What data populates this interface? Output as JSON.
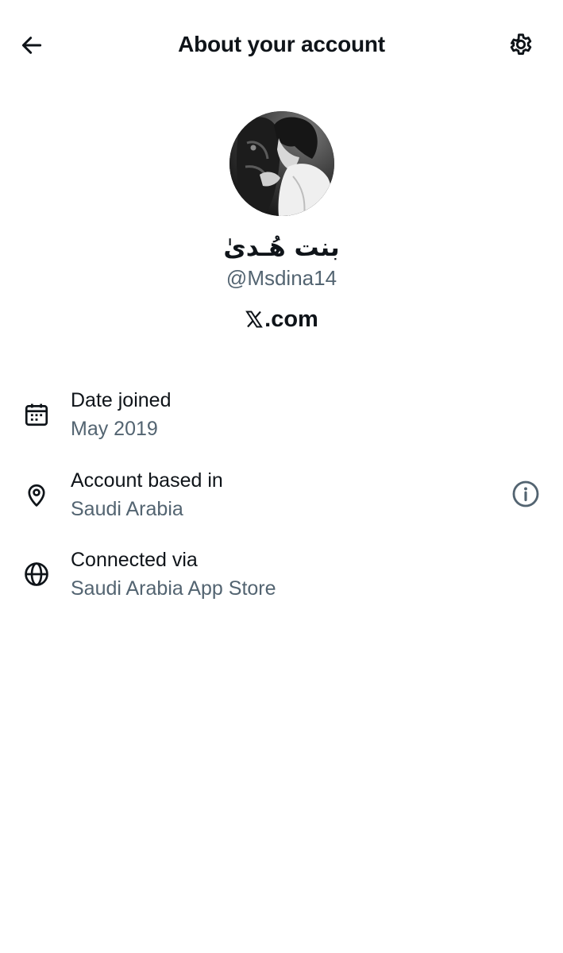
{
  "header": {
    "title": "About your account",
    "back_icon": "arrow-left-icon",
    "settings_icon": "gear-icon"
  },
  "profile": {
    "display_name": "بنت هُـدىٰ",
    "handle": "@Msdina14",
    "platform_suffix": ".com",
    "platform_logo": "x-logo-icon"
  },
  "details": [
    {
      "icon": "calendar-icon",
      "label": "Date joined",
      "value": "May 2019"
    },
    {
      "icon": "location-pin-icon",
      "label": "Account based in",
      "value": "Saudi Arabia",
      "trailing_icon": "info-icon"
    },
    {
      "icon": "globe-icon",
      "label": "Connected via",
      "value": "Saudi Arabia App Store"
    }
  ],
  "colors": {
    "text_primary": "#0f1419",
    "text_secondary": "#536471",
    "background": "#ffffff"
  }
}
